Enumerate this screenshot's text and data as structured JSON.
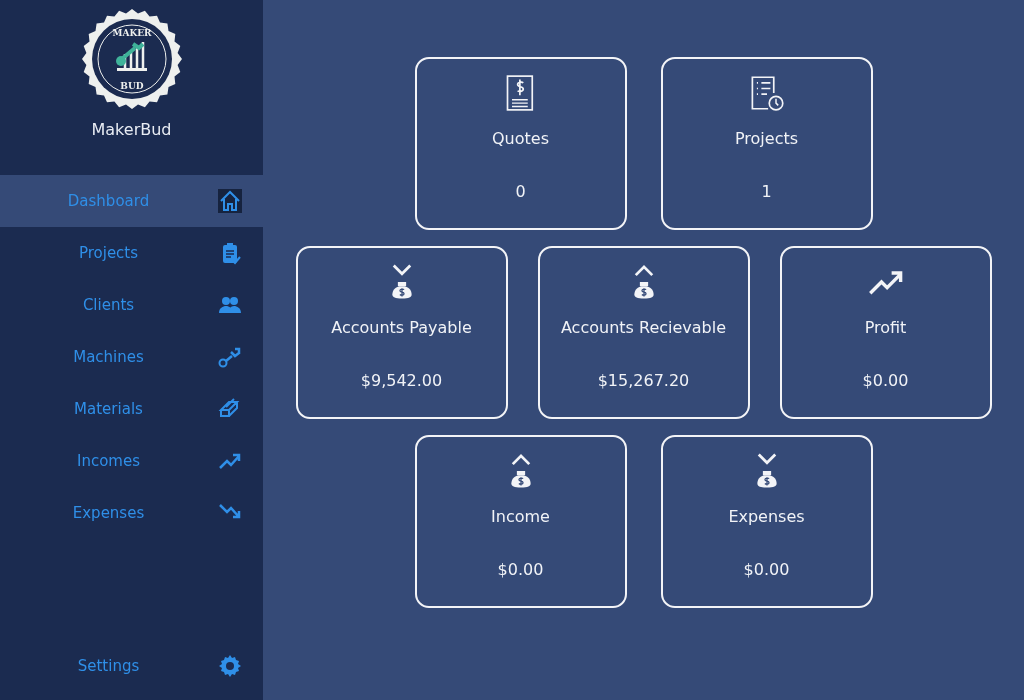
{
  "brand": {
    "logo_top": "MAKER",
    "logo_bottom": "BUD",
    "name": "MakerBud"
  },
  "nav": [
    {
      "label": "Dashboard",
      "selected": true
    },
    {
      "label": "Projects",
      "selected": false
    },
    {
      "label": "Clients",
      "selected": false
    },
    {
      "label": "Machines",
      "selected": false
    },
    {
      "label": "Materials",
      "selected": false
    },
    {
      "label": "Incomes",
      "selected": false
    },
    {
      "label": "Expenses",
      "selected": false
    }
  ],
  "settings": {
    "label": "Settings",
    "selected": false
  },
  "card_rows": [
    [
      {
        "title": "Quotes",
        "value": "0"
      },
      {
        "title": "Projects",
        "value": "1"
      }
    ],
    [
      {
        "title": "Accounts Payable",
        "value": "$9,542.00"
      },
      {
        "title": "Accounts Recievable",
        "value": "$15,267.20"
      },
      {
        "title": "Profit",
        "value": "$0.00"
      }
    ],
    [
      {
        "title": "Income",
        "value": "$0.00"
      },
      {
        "title": "Expenses",
        "value": "$0.00"
      }
    ]
  ]
}
